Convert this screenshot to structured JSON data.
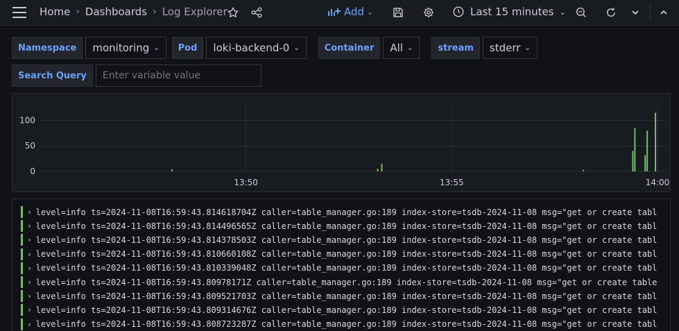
{
  "breadcrumb": {
    "home": "Home",
    "dashboards": "Dashboards",
    "current": "Log Explorer"
  },
  "toolbar": {
    "add_label": "Add",
    "time_range": "Last 15 minutes"
  },
  "variables": [
    {
      "label": "Namespace",
      "value": "monitoring"
    },
    {
      "label": "Pod",
      "value": "loki-backend-0"
    },
    {
      "label": "Container",
      "value": "All"
    },
    {
      "label": "stream",
      "value": "stderr"
    }
  ],
  "search": {
    "label": "Search Query",
    "placeholder": "Enter variable value"
  },
  "chart_data": {
    "type": "bar",
    "x_tick_labels": [
      "13:50",
      "13:55",
      "14:00"
    ],
    "y_ticks": [
      0,
      50,
      100
    ],
    "ylim": [
      0,
      140
    ],
    "xlim_minutes": [
      -15,
      0
    ],
    "grid": true,
    "series": [
      {
        "color": "#73bf69",
        "points": [
          {
            "t": -11.8,
            "v": 4
          },
          {
            "t": -6.8,
            "v": 5
          },
          {
            "t": -6.7,
            "v": 15
          },
          {
            "t": -1.8,
            "v": 3
          },
          {
            "t": -0.6,
            "v": 40
          },
          {
            "t": -0.55,
            "v": 85
          },
          {
            "t": -0.3,
            "v": 32
          },
          {
            "t": -0.25,
            "v": 80
          },
          {
            "t": -0.05,
            "v": 115
          }
        ]
      }
    ]
  },
  "logs": [
    "level=info ts=2024-11-08T16:59:43.814618704Z caller=table_manager.go:189 index-store=tsdb-2024-11-08 msg=\"get or create tabl",
    "level=info ts=2024-11-08T16:59:43.814496565Z caller=table_manager.go:189 index-store=tsdb-2024-11-08 msg=\"get or create tabl",
    "level=info ts=2024-11-08T16:59:43.814378503Z caller=table_manager.go:189 index-store=tsdb-2024-11-08 msg=\"get or create tabl",
    "level=info ts=2024-11-08T16:59:43.810660108Z caller=table_manager.go:189 index-store=tsdb-2024-11-08 msg=\"get or create tabl",
    "level=info ts=2024-11-08T16:59:43.810339048Z caller=table_manager.go:189 index-store=tsdb-2024-11-08 msg=\"get or create tabl",
    "level=info ts=2024-11-08T16:59:43.80978171Z caller=table_manager.go:189 index-store=tsdb-2024-11-08 msg=\"get or create table",
    "level=info ts=2024-11-08T16:59:43.809521703Z caller=table_manager.go:189 index-store=tsdb-2024-11-08 msg=\"get or create tabl",
    "level=info ts=2024-11-08T16:59:43.809314676Z caller=table_manager.go:189 index-store=tsdb-2024-11-08 msg=\"get or create tabl",
    "level=info ts=2024-11-08T16:59:43.808723287Z caller=table_manager.go:189 index-store=tsdb-2024-11-08 msg=\"get or create tabl"
  ]
}
